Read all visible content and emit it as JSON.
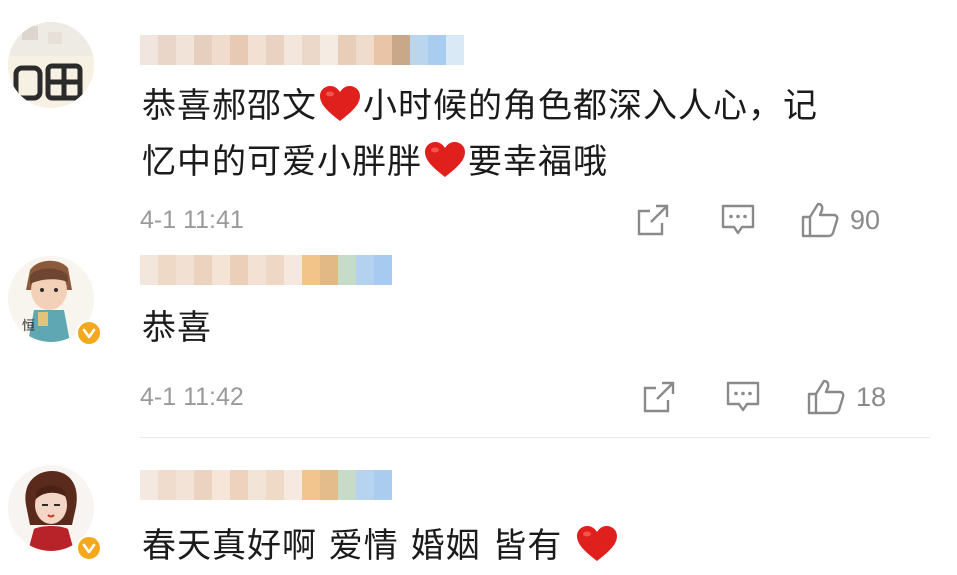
{
  "comments": [
    {
      "text_parts": [
        "恭喜郝邵文",
        "小时候的角色都深入人心，记",
        "忆中的可爱小胖胖",
        "要幸福哦"
      ],
      "time": "4-1 11:41",
      "likes": "90",
      "avatar_text": "喵"
    },
    {
      "text_parts": [
        "恭喜"
      ],
      "time": "4-1 11:42",
      "likes": "18",
      "avatar_text": "恒"
    },
    {
      "text_parts": [
        "春天真好啊 爱情 婚姻 皆有"
      ]
    }
  ],
  "icons": {
    "share": "share-icon",
    "comment": "comment-icon",
    "like": "thumb-up-icon",
    "heart": "red-heart-emoji",
    "verified": "verified-badge-icon"
  },
  "colors": {
    "text": "#1b1b1b",
    "meta": "#9a9a9a",
    "heart": "#e0201c",
    "verified": "#f4a81c"
  }
}
